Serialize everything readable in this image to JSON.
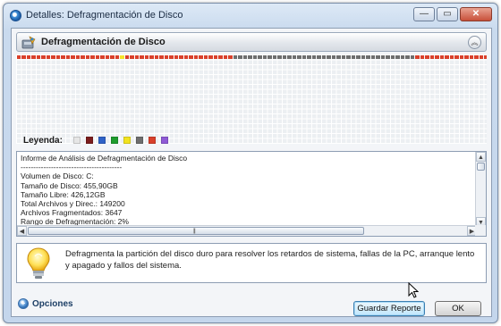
{
  "window": {
    "title": "Detalles: Defragmentación de Disco",
    "controls": {
      "minimize": "—",
      "maximize": "▭",
      "close": "✕"
    }
  },
  "header": {
    "title": "Defragmentación de Disco",
    "collapse_glyph": "︽"
  },
  "disk_map": {
    "colors": {
      "free": "#eceff2",
      "fragmented": "#d9402b",
      "system": "#6e6e6e",
      "yellow": "#f4e32a",
      "dark": "#2a2a2a"
    },
    "row0": "rrrrrrrrrrrrrrrrrrrrryrrrrrrrrrrrrrrrrrrrrrrgggggggggggggggggggggggggggggggggggggrrrrrrrrrrrrrrrrrrrrrrrrrrrrrrrrrrrrrrrrrrrrrrrrrrrdrrrrrrrrrrrrrrrrrrrrrrrrrrrrrrrrrrrrrrrrrrrrrrrrrrrrrrrrrrrrrrrrrrrrrrrrrr",
    "extra_blocks": [
      {
        "row": 8,
        "col": 115,
        "color": "fragmented"
      }
    ]
  },
  "legend": {
    "label": "Leyenda:",
    "swatches": [
      "#e6e6e6",
      "#7b1d1d",
      "#2f62c7",
      "#1e9c2e",
      "#f2e31f",
      "#6e6e6e",
      "#d9402b",
      "#8f5ad6"
    ]
  },
  "report": {
    "lines": [
      "Informe de Análisis de Defragmentación de Disco",
      "----------------------------------------",
      "Volumen de Disco: C:",
      "Tamaño de Disco: 455,90GB",
      "Tamaño Libre: 426,12GB",
      "Total Archivos y Direc.: 149200",
      "Archivos Fragmentados: 3647",
      "Rango de Defragmentación: 2%"
    ]
  },
  "tip": {
    "text": "Defragmenta la partición del disco duro para resolver los retardos de sistema, fallas de la PC, arranque lento y apagado y fallos del sistema."
  },
  "footer": {
    "options_label": "Opciones",
    "save_label": "Guardar Reporte",
    "ok_label": "OK"
  }
}
